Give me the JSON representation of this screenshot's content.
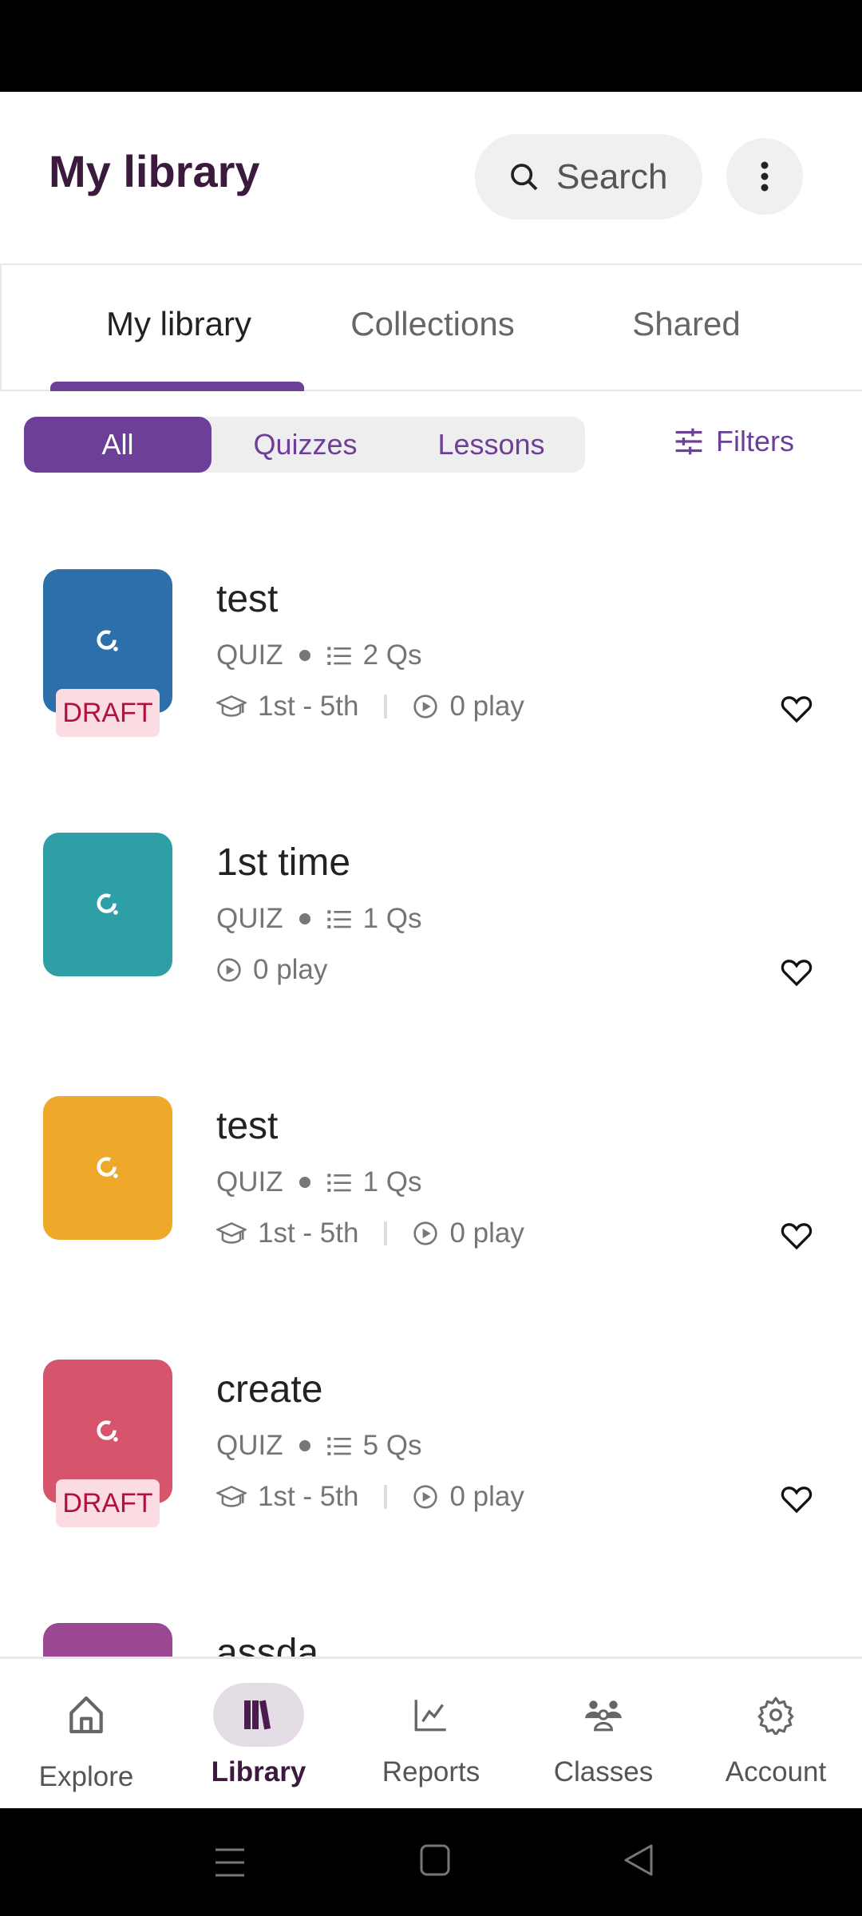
{
  "header": {
    "title": "My library",
    "search_label": "Search"
  },
  "tabs": [
    {
      "label": "My library",
      "active": true
    },
    {
      "label": "Collections"
    },
    {
      "label": "Shared"
    }
  ],
  "segments": [
    {
      "label": "All",
      "active": true
    },
    {
      "label": "Quizzes"
    },
    {
      "label": "Lessons"
    }
  ],
  "filters_label": "Filters",
  "items": [
    {
      "title": "test",
      "type": "QUIZ",
      "questions": "2 Qs",
      "grade": "1st - 5th",
      "plays": "0 play",
      "draft": "DRAFT",
      "color": "#2d6fab"
    },
    {
      "title": "1st time",
      "type": "QUIZ",
      "questions": "1 Qs",
      "plays": "0 play",
      "color": "#2e9fa6"
    },
    {
      "title": "test",
      "type": "QUIZ",
      "questions": "1 Qs",
      "grade": "1st - 5th",
      "plays": "0 play",
      "color": "#eea92b"
    },
    {
      "title": "create",
      "type": "QUIZ",
      "questions": "5 Qs",
      "grade": "1st - 5th",
      "plays": "0 play",
      "draft": "DRAFT",
      "color": "#d6546c"
    },
    {
      "title": "assda",
      "color": "#9a4891"
    }
  ],
  "nav": [
    {
      "label": "Explore"
    },
    {
      "label": "Library",
      "active": true
    },
    {
      "label": "Reports"
    },
    {
      "label": "Classes"
    },
    {
      "label": "Account"
    }
  ],
  "colors": {
    "accent": "#6c3f98",
    "title": "#3b1a3d",
    "draft_bg": "#fbdce3",
    "draft_text": "#b0123c"
  }
}
